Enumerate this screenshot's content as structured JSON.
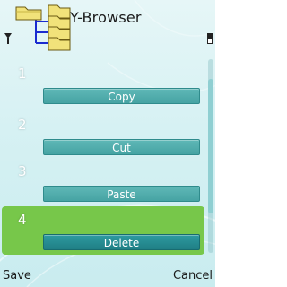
{
  "app": {
    "title": "Y-Browser",
    "icon": "folder-tree-icon"
  },
  "status": {
    "signal_icon": "signal-antenna-icon",
    "battery_icon": "battery-level-icon"
  },
  "list": {
    "items": [
      {
        "number": "1",
        "action": "Copy"
      },
      {
        "number": "2",
        "action": "Cut"
      },
      {
        "number": "3",
        "action": "Paste"
      },
      {
        "number": "4",
        "action": "Delete"
      }
    ],
    "selected_index": 3
  },
  "softkeys": {
    "left": "Save",
    "right": "Cancel"
  },
  "colors": {
    "selection": "#77c74a",
    "button": "#46a3a3",
    "background": "#d6f1f3"
  }
}
